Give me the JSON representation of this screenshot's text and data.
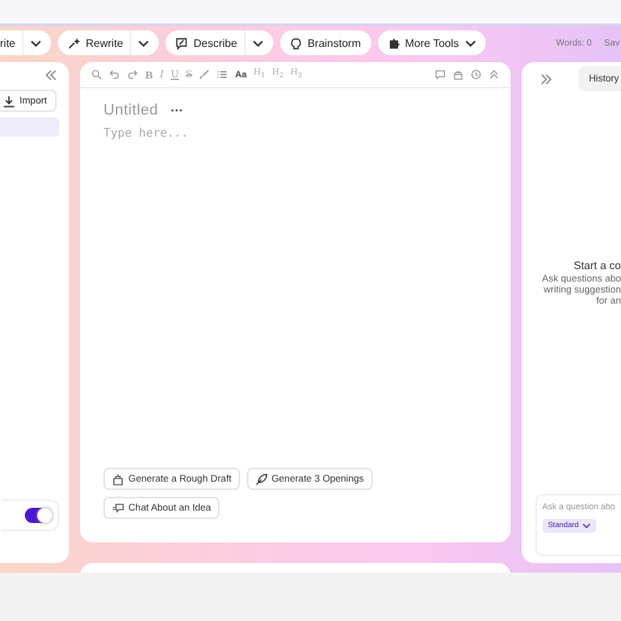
{
  "toolbar": {
    "tools": [
      {
        "label": "rite",
        "kind": "split"
      },
      {
        "label": "Rewrite",
        "kind": "split"
      },
      {
        "label": "Describe",
        "kind": "split"
      },
      {
        "label": "Brainstorm",
        "kind": "plain"
      },
      {
        "label": "More Tools",
        "kind": "menu"
      }
    ],
    "word_count": "Words: 0",
    "save": "Sav"
  },
  "left_panel": {
    "import": "Import",
    "items": [
      {
        "selected": true
      }
    ],
    "toggle": {
      "on": true
    }
  },
  "editor": {
    "format_labels": [
      "B",
      "I",
      "U",
      "S"
    ],
    "heading_labels": [
      "Aa",
      "H$_{1}$",
      "H$_{2}$",
      "H$_{3}$"
    ],
    "title": "Untitled",
    "more": "···",
    "placeholder": "Type here...",
    "actions": [
      {
        "label": "Generate a Rough Draft",
        "kind": "draft"
      },
      {
        "label": "Generate 3 Openings",
        "kind": "openings"
      },
      {
        "label": "Chat About an Idea",
        "kind": "chat"
      }
    ]
  },
  "right_panel": {
    "history": "History",
    "empty_title": "Start a co",
    "empty_lines": [
      "Ask questions abo",
      "writing suggestion",
      "for an"
    ],
    "input_placeholder": "Ask a question abo",
    "mode": "Standard"
  }
}
